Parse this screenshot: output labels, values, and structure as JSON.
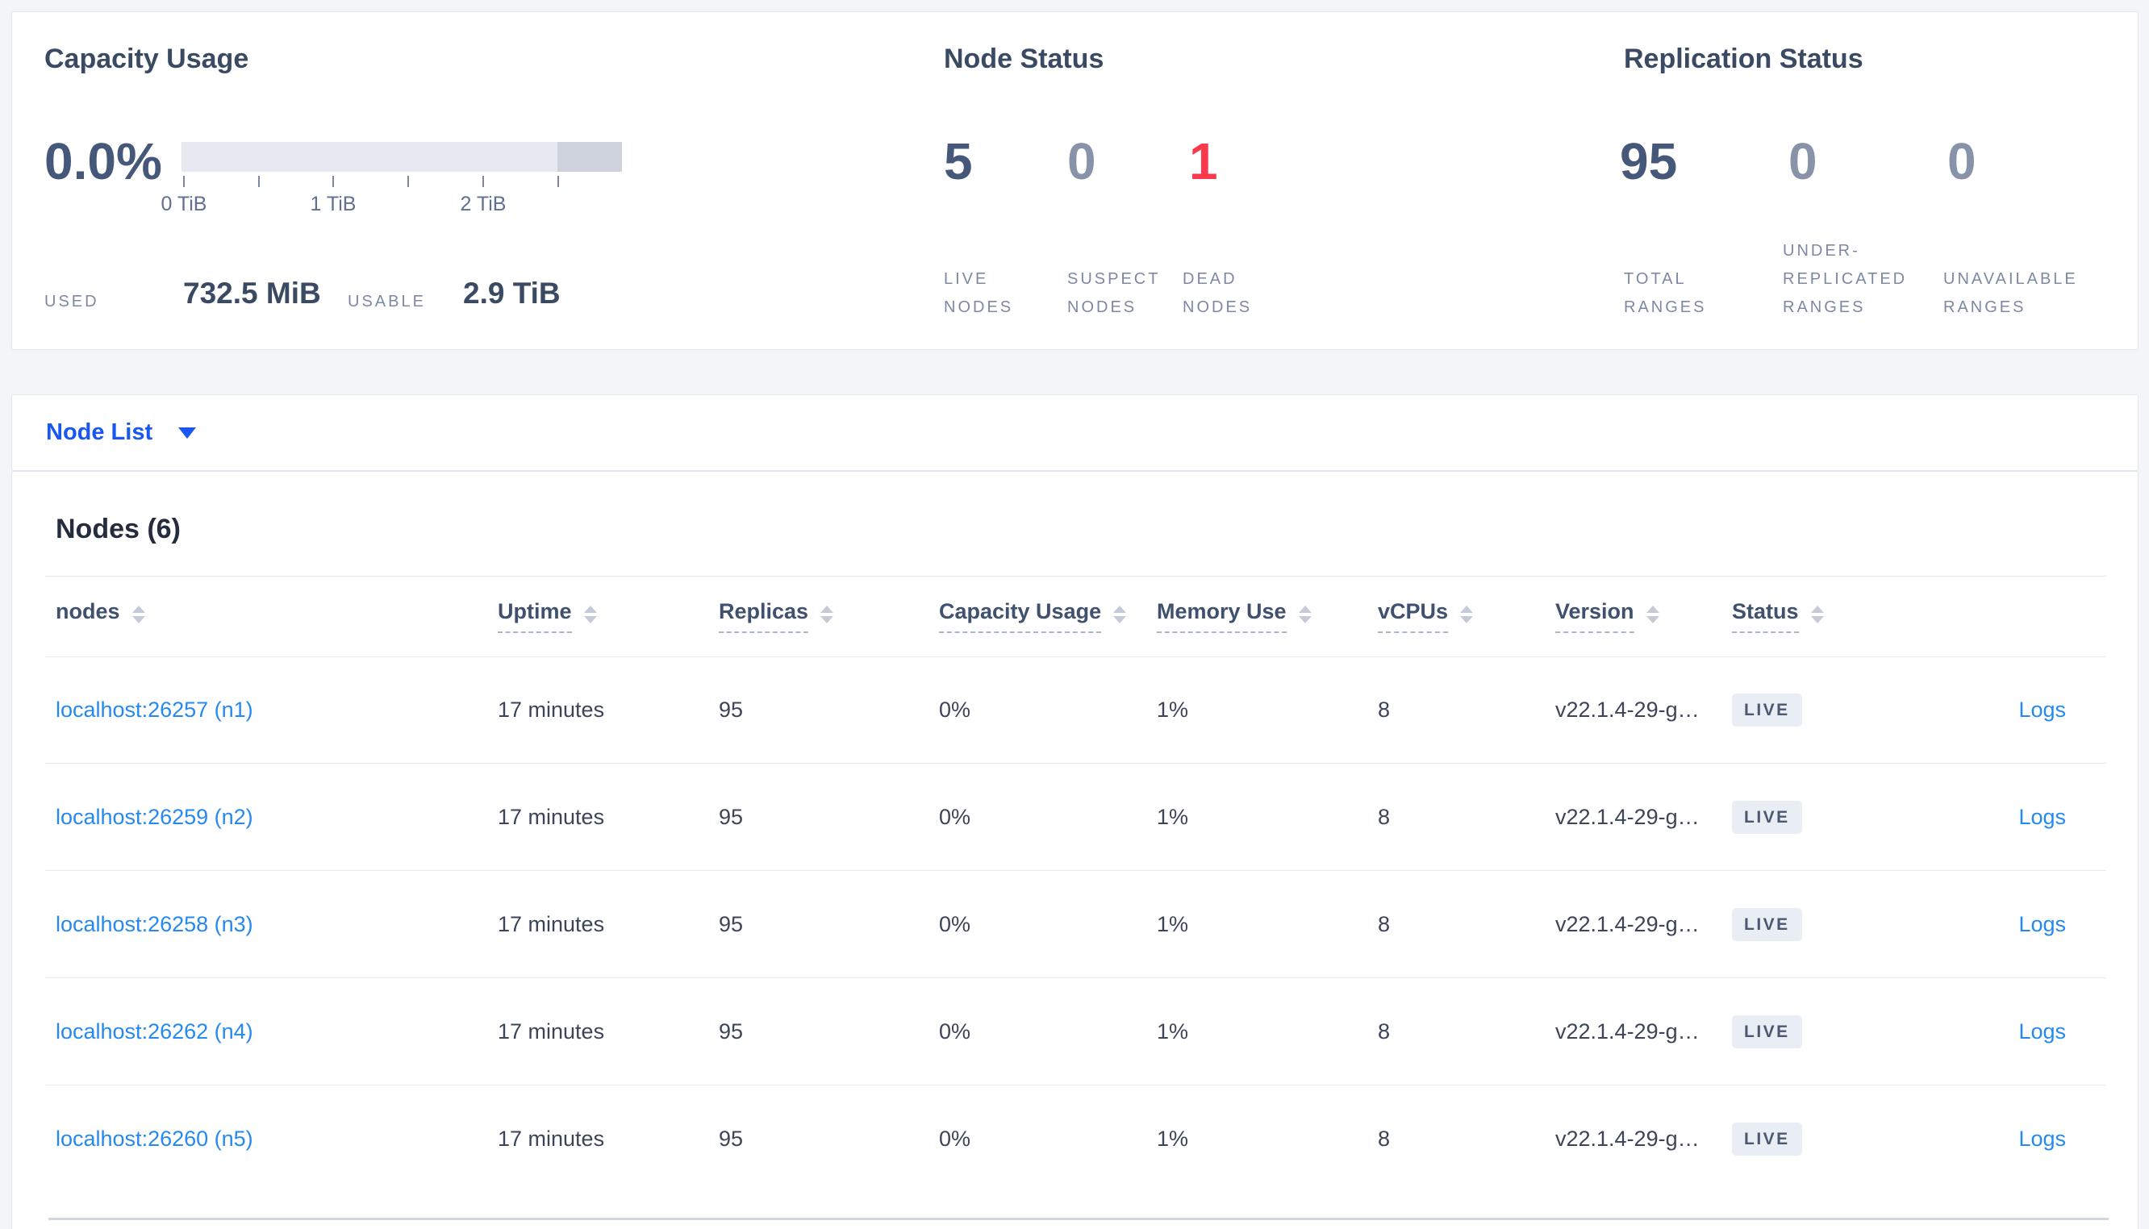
{
  "summary": {
    "capacity": {
      "title": "Capacity Usage",
      "percent": "0.0%",
      "tick_labels": [
        "0 TiB",
        "1 TiB",
        "2 TiB"
      ],
      "used_label": "USED",
      "used_value": "732.5 MiB",
      "usable_label": "USABLE",
      "usable_value": "2.9 TiB"
    },
    "node_status": {
      "title": "Node Status",
      "metrics": [
        {
          "value": "5",
          "label": "LIVE NODES"
        },
        {
          "value": "0",
          "label": "SUSPECT NODES"
        },
        {
          "value": "1",
          "label": "DEAD NODES"
        }
      ]
    },
    "replication_status": {
      "title": "Replication Status",
      "metrics": [
        {
          "value": "95",
          "label": "TOTAL RANGES"
        },
        {
          "value": "0",
          "label": "UNDER-REPLICATED RANGES"
        },
        {
          "value": "0",
          "label": "UNAVAILABLE RANGES"
        }
      ]
    }
  },
  "view_selector": {
    "label": "Node List"
  },
  "nodes": {
    "title": "Nodes (6)",
    "columns": [
      {
        "label": "nodes"
      },
      {
        "label": "Uptime"
      },
      {
        "label": "Replicas"
      },
      {
        "label": "Capacity Usage"
      },
      {
        "label": "Memory Use"
      },
      {
        "label": "vCPUs"
      },
      {
        "label": "Version"
      },
      {
        "label": "Status"
      }
    ],
    "rows": [
      {
        "node": "localhost:26257 (n1)",
        "uptime": "17 minutes",
        "replicas": "95",
        "capacity_usage": "0%",
        "memory_use": "1%",
        "vcpus": "8",
        "version": "v22.1.4-29-g…",
        "status": "LIVE",
        "logs_label": "Logs"
      },
      {
        "node": "localhost:26259 (n2)",
        "uptime": "17 minutes",
        "replicas": "95",
        "capacity_usage": "0%",
        "memory_use": "1%",
        "vcpus": "8",
        "version": "v22.1.4-29-g…",
        "status": "LIVE",
        "logs_label": "Logs"
      },
      {
        "node": "localhost:26258 (n3)",
        "uptime": "17 minutes",
        "replicas": "95",
        "capacity_usage": "0%",
        "memory_use": "1%",
        "vcpus": "8",
        "version": "v22.1.4-29-g…",
        "status": "LIVE",
        "logs_label": "Logs"
      },
      {
        "node": "localhost:26262 (n4)",
        "uptime": "17 minutes",
        "replicas": "95",
        "capacity_usage": "0%",
        "memory_use": "1%",
        "vcpus": "8",
        "version": "v22.1.4-29-g…",
        "status": "LIVE",
        "logs_label": "Logs"
      },
      {
        "node": "localhost:26260 (n5)",
        "uptime": "17 minutes",
        "replicas": "95",
        "capacity_usage": "0%",
        "memory_use": "1%",
        "vcpus": "8",
        "version": "v22.1.4-29-g…",
        "status": "LIVE",
        "logs_label": "Logs"
      }
    ]
  },
  "colors": {
    "accent_blue": "#1a57f2",
    "link_blue": "#2689ef",
    "dead_red": "#fb394d",
    "dark_number": "#46587a",
    "muted_number": "#8893a9",
    "badge_bg": "#e9edf4",
    "bar_light": "#e7e9f1",
    "bar_dark": "#cdd2dd"
  }
}
